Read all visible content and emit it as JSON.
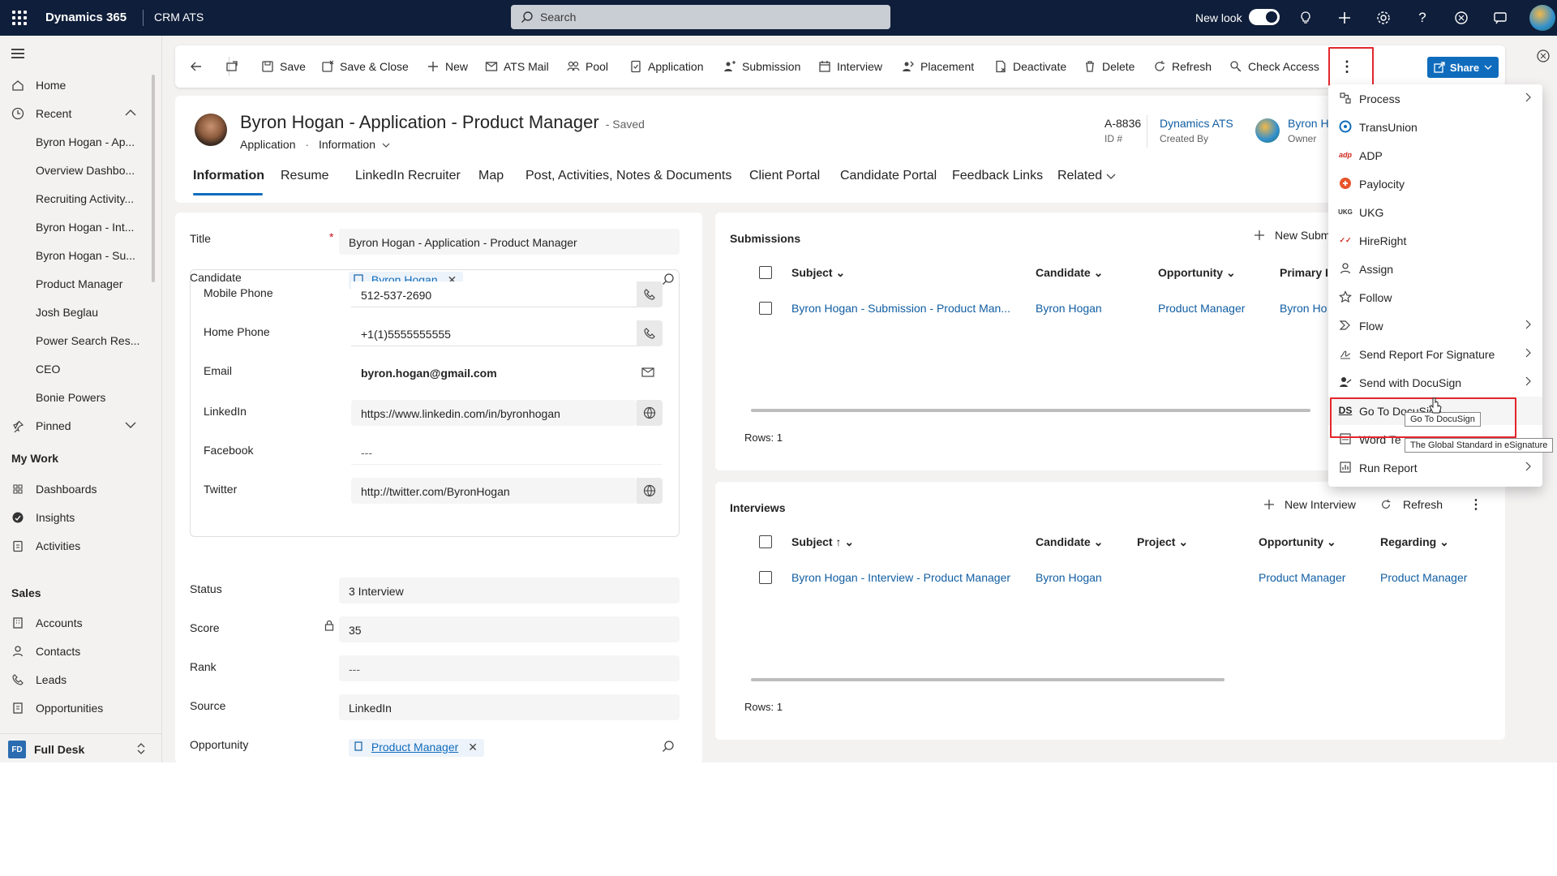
{
  "topbar": {
    "brand": "Dynamics 365",
    "app": "CRM ATS",
    "search_placeholder": "Search",
    "new_look_label": "New look"
  },
  "sidebar": {
    "items": [
      {
        "label": "Home"
      },
      {
        "label": "Recent"
      },
      {
        "label": "Byron Hogan - Ap..."
      },
      {
        "label": "Overview Dashbo..."
      },
      {
        "label": "Recruiting Activity..."
      },
      {
        "label": "Byron Hogan - Int..."
      },
      {
        "label": "Byron Hogan - Su..."
      },
      {
        "label": "Product Manager"
      },
      {
        "label": "Josh Beglau"
      },
      {
        "label": "Power Search Res..."
      },
      {
        "label": "CEO"
      },
      {
        "label": "Bonie Powers"
      },
      {
        "label": "Pinned"
      }
    ],
    "my_work_heading": "My Work",
    "my_work": [
      {
        "label": "Dashboards"
      },
      {
        "label": "Insights"
      },
      {
        "label": "Activities"
      }
    ],
    "sales_heading": "Sales",
    "sales": [
      {
        "label": "Accounts"
      },
      {
        "label": "Contacts"
      },
      {
        "label": "Leads"
      },
      {
        "label": "Opportunities"
      }
    ],
    "area_badge": "FD",
    "area_label": "Full Desk"
  },
  "commandbar": {
    "save": "Save",
    "save_close": "Save & Close",
    "new": "New",
    "ats_mail": "ATS Mail",
    "pool": "Pool",
    "application": "Application",
    "submission": "Submission",
    "interview": "Interview",
    "placement": "Placement",
    "deactivate": "Deactivate",
    "delete": "Delete",
    "refresh": "Refresh",
    "check_access": "Check Access",
    "share": "Share"
  },
  "header": {
    "title": "Byron Hogan - Application - Product Manager",
    "saved": "- Saved",
    "entity": "Application",
    "form": "Information",
    "id_value": "A-8836",
    "id_label": "ID #",
    "created_by_value": "Dynamics ATS",
    "created_by_label": "Created By",
    "owner_value": "Byron H",
    "owner_label": "Owner"
  },
  "tabs": [
    "Information",
    "Resume",
    "LinkedIn Recruiter",
    "Map",
    "Post, Activities, Notes & Documents",
    "Client Portal",
    "Candidate Portal",
    "Feedback Links",
    "Related"
  ],
  "form": {
    "title_label": "Title",
    "title_value": "Byron Hogan - Application - Product Manager",
    "candidate_label": "Candidate",
    "candidate_value": "Byron Hogan",
    "mobile_label": "Mobile Phone",
    "mobile_value": "512-537-2690",
    "home_label": "Home Phone",
    "home_value": "+1(1)5555555555",
    "email_label": "Email",
    "email_value": "byron.hogan@gmail.com",
    "linkedin_label": "LinkedIn",
    "linkedin_value": "https://www.linkedin.com/in/byronhogan",
    "facebook_label": "Facebook",
    "facebook_value": "---",
    "twitter_label": "Twitter",
    "twitter_value": "http://twitter.com/ByronHogan",
    "status_label": "Status",
    "status_value": "3 Interview",
    "score_label": "Score",
    "score_value": "35",
    "rank_label": "Rank",
    "rank_value": "---",
    "source_label": "Source",
    "source_value": "LinkedIn",
    "opportunity_label": "Opportunity",
    "opportunity_value": "Product Manager"
  },
  "submissions": {
    "title": "Submissions",
    "new_label": "New Subm",
    "columns": [
      "Subject",
      "Candidate",
      "Opportunity",
      "Primary I"
    ],
    "rows": [
      {
        "subject": "Byron Hogan - Submission - Product Man...",
        "candidate": "Byron Hogan",
        "opportunity": "Product Manager",
        "primary": "Byron Ho"
      }
    ],
    "rows_label": "Rows: 1"
  },
  "interviews": {
    "title": "Interviews",
    "new_label": "New Interview",
    "refresh_label": "Refresh",
    "columns": [
      "Subject",
      "Candidate",
      "Project",
      "Opportunity",
      "Regarding"
    ],
    "rows": [
      {
        "subject": "Byron Hogan - Interview - Product Manager",
        "candidate": "Byron Hogan",
        "opportunity": "Product Manager",
        "regarding": "Product Manager"
      }
    ],
    "rows_label": "Rows: 1"
  },
  "menu": {
    "items": [
      {
        "label": "Process",
        "submenu": true,
        "icon": "process-icon"
      },
      {
        "label": "TransUnion",
        "submenu": false,
        "icon": "transunion-icon"
      },
      {
        "label": "ADP",
        "submenu": false,
        "icon": "adp-icon"
      },
      {
        "label": "Paylocity",
        "submenu": false,
        "icon": "paylocity-icon"
      },
      {
        "label": "UKG",
        "submenu": false,
        "icon": "ukg-icon"
      },
      {
        "label": "HireRight",
        "submenu": false,
        "icon": "hireright-icon"
      },
      {
        "label": "Assign",
        "submenu": false,
        "icon": "person-icon"
      },
      {
        "label": "Follow",
        "submenu": false,
        "icon": "star-icon"
      },
      {
        "label": "Flow",
        "submenu": true,
        "icon": "flow-icon"
      },
      {
        "label": "Send Report For Signature",
        "submenu": true,
        "icon": "signature-icon"
      },
      {
        "label": "Send with DocuSign",
        "submenu": true,
        "icon": "docusign-send-icon"
      },
      {
        "label": "Go To DocuSign",
        "submenu": false,
        "icon": "docusign-icon"
      },
      {
        "label": "Word Te",
        "submenu": false,
        "icon": "word-template-icon"
      },
      {
        "label": "Run Report",
        "submenu": true,
        "icon": "report-icon"
      }
    ],
    "tooltip_title": "Go To DocuSign",
    "tooltip_desc": "The Global Standard in eSignature"
  },
  "colors": {
    "topbar": "#0f1e3a",
    "accent": "#0f6cbd",
    "highlight": "#e3262c"
  }
}
